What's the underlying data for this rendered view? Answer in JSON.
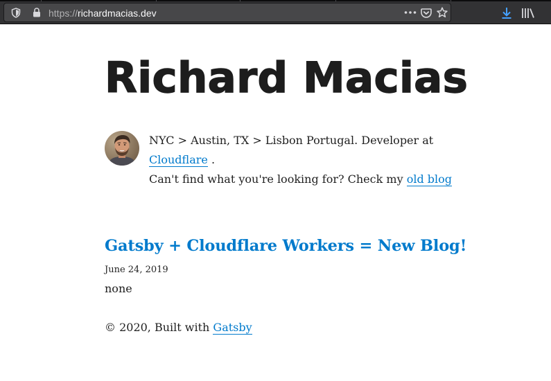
{
  "browser": {
    "url_scheme": "https://",
    "url_host": "richardmacias.dev",
    "icons": {
      "tracking": "shield-icon",
      "security": "lock-icon",
      "page_actions": "ellipsis-icon",
      "pocket": "pocket-icon",
      "bookmark": "star-icon",
      "downloads": "download-icon",
      "library": "library-icon"
    },
    "colors": {
      "toolbar": "#323234",
      "urlbar": "#474749",
      "download_accent": "#45a1ff"
    }
  },
  "site": {
    "title": "Richard Macias"
  },
  "bio": {
    "avatar": "avatar-photo",
    "text_before_link": "NYC > Austin, TX > Lisbon Portugal. Developer at ",
    "company_link": "Cloudflare",
    "text_after_company": " .",
    "text_line2": "Can't find what you're looking for? Check my ",
    "old_blog_link": "old blog"
  },
  "posts": [
    {
      "title": "Gatsby + Cloudflare Workers = New Blog!",
      "date": "June 24, 2019",
      "excerpt": "none"
    }
  ],
  "footer": {
    "text": "© 2020, Built with ",
    "link": "Gatsby"
  },
  "theme": {
    "link_color": "#007acc",
    "title_color": "#1d1d1d"
  }
}
